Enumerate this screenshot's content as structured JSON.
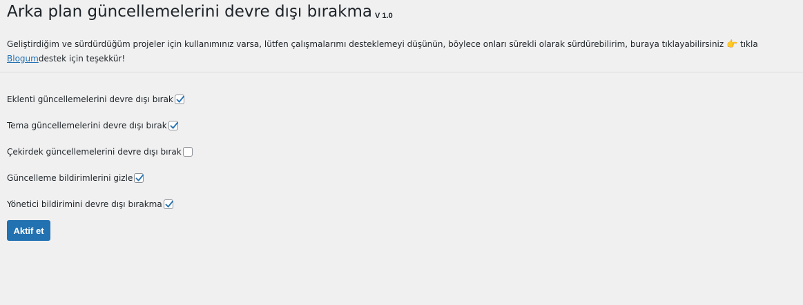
{
  "header": {
    "title": "Arka plan güncellemelerini devre dışı bırakma",
    "version": "V 1.0"
  },
  "intro": {
    "text_before": "Geliştirdiğim ve sürdürdüğüm projeler için kullanımınız varsa, lütfen çalışmalarımı desteklemeyi düşünün, böylece onları sürekli olarak sürdürebilirim, buraya tıklayabilirsiniz ",
    "pointer_emoji": "👉",
    "text_click": " tıkla ",
    "link_label": "Blogum",
    "text_after": "destek için teşekkür!"
  },
  "options": [
    {
      "label": "Eklenti güncellemelerini devre dışı bırak",
      "checked": true
    },
    {
      "label": "Tema güncellemelerini devre dışı bırak",
      "checked": true
    },
    {
      "label": "Çekirdek güncellemelerini devre dışı bırak",
      "checked": false
    },
    {
      "label": "Güncelleme bildirimlerini gizle",
      "checked": true
    },
    {
      "label": "Yönetici bildirimini devre dışı bırakma",
      "checked": true
    }
  ],
  "submit": {
    "label": "Aktif et"
  },
  "colors": {
    "background": "#f0f0f1",
    "primary": "#2271b1",
    "checkmark": "#2271b1",
    "pointer_emoji": "#f4b400"
  }
}
